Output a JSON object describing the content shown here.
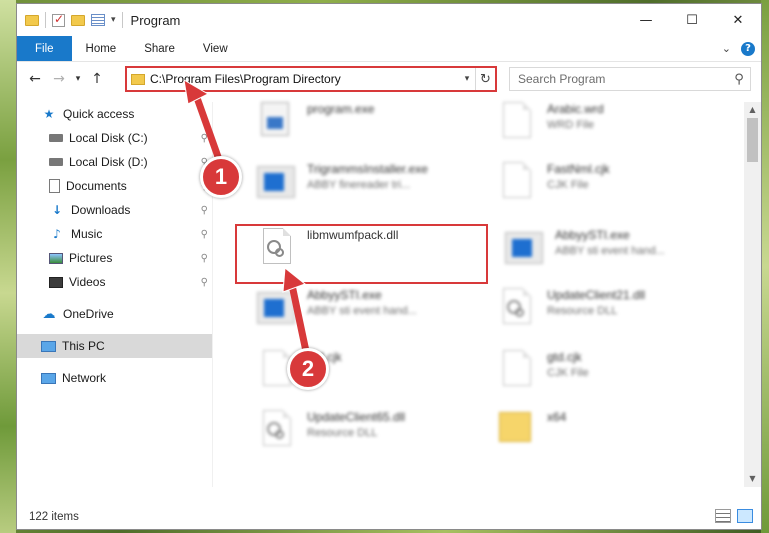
{
  "window": {
    "title": "Program"
  },
  "ribbon": {
    "tabs": [
      "File",
      "Home",
      "Share",
      "View"
    ]
  },
  "address": {
    "path": "C:\\Program Files\\Program Directory"
  },
  "search": {
    "placeholder": "Search Program"
  },
  "nav": {
    "items": [
      {
        "label": "Quick access",
        "icon": "star-icon"
      },
      {
        "label": "Local Disk (C:)",
        "icon": "drive-icon",
        "pinned": true
      },
      {
        "label": "Local Disk (D:)",
        "icon": "drive-icon",
        "pinned": true
      },
      {
        "label": "Documents",
        "icon": "document-icon",
        "pinned": true
      },
      {
        "label": "Downloads",
        "icon": "download-icon",
        "pinned": true
      },
      {
        "label": "Music",
        "icon": "music-icon",
        "pinned": true
      },
      {
        "label": "Pictures",
        "icon": "picture-icon",
        "pinned": true
      },
      {
        "label": "Videos",
        "icon": "video-icon",
        "pinned": true
      },
      {
        "label": "OneDrive",
        "icon": "cloud-icon"
      },
      {
        "label": "This PC",
        "icon": "computer-icon",
        "selected": true
      },
      {
        "label": "Network",
        "icon": "network-icon"
      }
    ]
  },
  "files": [
    {
      "name": "program.exe",
      "desc": "",
      "icon": "exe-icon"
    },
    {
      "name": "Arabic.wrd",
      "desc": "WRD File",
      "icon": "file-icon"
    },
    {
      "name": "TrigrammsInstaller.exe",
      "desc": "ABBY finereader tri...",
      "icon": "app-icon"
    },
    {
      "name": "FastNml.cjk",
      "desc": "CJK File",
      "icon": "file-icon"
    },
    {
      "name": "libmwumfpack.dll",
      "desc": "",
      "icon": "dll-gear-icon",
      "highlighted": true
    },
    {
      "name": "AbbyySTI.exe",
      "desc": "ABBY sti event hand...",
      "icon": "app-icon"
    },
    {
      "name": "AbbyySTI.exe",
      "desc": "ABBY sti event hand...",
      "icon": "app-icon"
    },
    {
      "name": "UpdateClient21.dll",
      "desc": "Resource DLL",
      "icon": "dll-gear-icon"
    },
    {
      "name": "gtd.cjk",
      "desc": "",
      "icon": "file-icon"
    },
    {
      "name": "gtd.cjk",
      "desc": "CJK File",
      "icon": "file-icon"
    },
    {
      "name": "UpdateClient65.dll",
      "desc": "Resource DLL",
      "icon": "dll-gear-icon"
    },
    {
      "name": "x64",
      "desc": "",
      "icon": "folder-icon"
    }
  ],
  "status": {
    "item_count": "122 items"
  },
  "annotations": {
    "step1": "1",
    "step2": "2"
  },
  "colors": {
    "accent": "#1979ca",
    "highlight": "#d8393a"
  }
}
